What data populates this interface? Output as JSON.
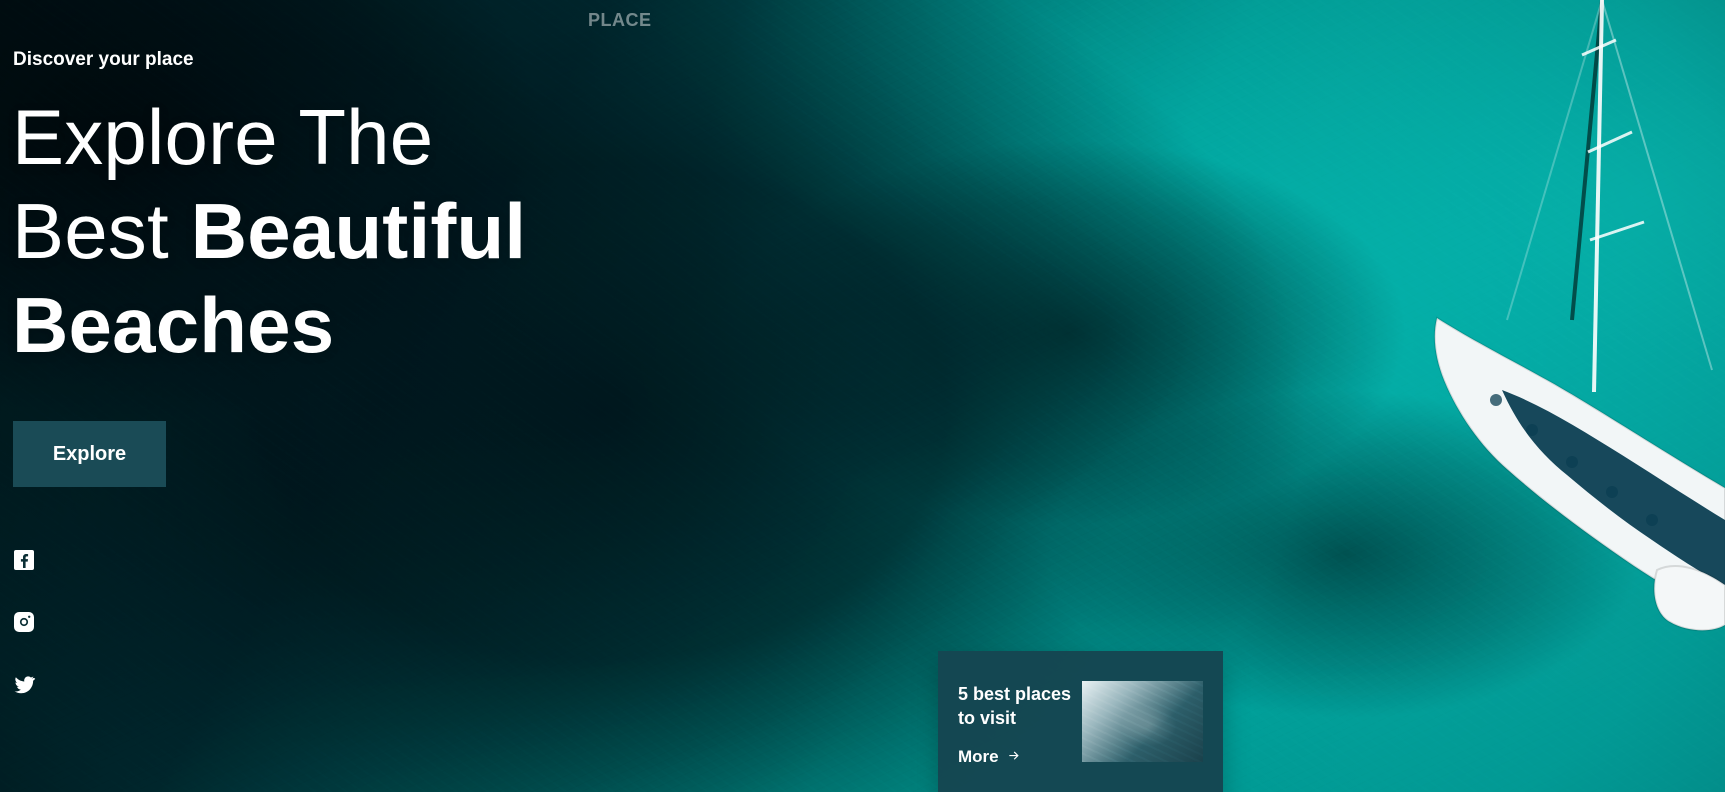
{
  "header": {
    "brand": "PLACE"
  },
  "hero": {
    "subtitle": "Discover your place",
    "headline": {
      "line1": "Explore The",
      "line2_light": "Best ",
      "line2_bold": "Beautiful",
      "line3_bold": "Beaches"
    },
    "cta_label": "Explore"
  },
  "social": {
    "icons": [
      {
        "name": "facebook-icon"
      },
      {
        "name": "instagram-icon"
      },
      {
        "name": "twitter-icon"
      }
    ]
  },
  "card": {
    "title": "5 best places to visit",
    "more_label": "More"
  },
  "colors": {
    "overlay_button": "#1a4b56",
    "card_bg": "#144652",
    "text": "#ffffff"
  }
}
